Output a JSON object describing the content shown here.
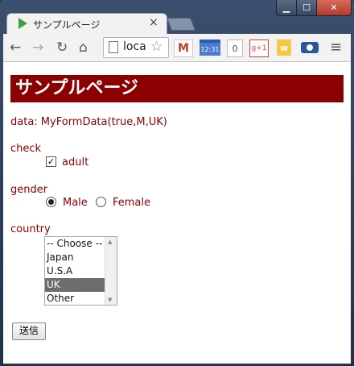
{
  "browser": {
    "tab_title": "サンプルページ",
    "tab_close": "×",
    "address_text": "loca",
    "window_controls": {
      "minimize": "▁",
      "maximize": "☐",
      "close": "✕"
    },
    "extensions": {
      "gmail": "M",
      "calendar_day": "12:31",
      "counter": "0",
      "gplus": "g+1",
      "w": "w"
    }
  },
  "page": {
    "heading": "サンプルページ",
    "data_line": "data: MyFormData(true,M,UK)",
    "check": {
      "label": "check",
      "option": "adult",
      "checked": true
    },
    "gender": {
      "label": "gender",
      "options": [
        "Male",
        "Female"
      ],
      "selected": "Male"
    },
    "country": {
      "label": "country",
      "options": [
        "-- Choose --",
        "Japan",
        "U.S.A",
        "UK",
        "Other"
      ],
      "selected": "UK"
    },
    "submit_label": "送信"
  },
  "colors": {
    "accent": "#8b0000",
    "heading_text": "#ffffff",
    "selected_option": "#6d6d6d"
  }
}
